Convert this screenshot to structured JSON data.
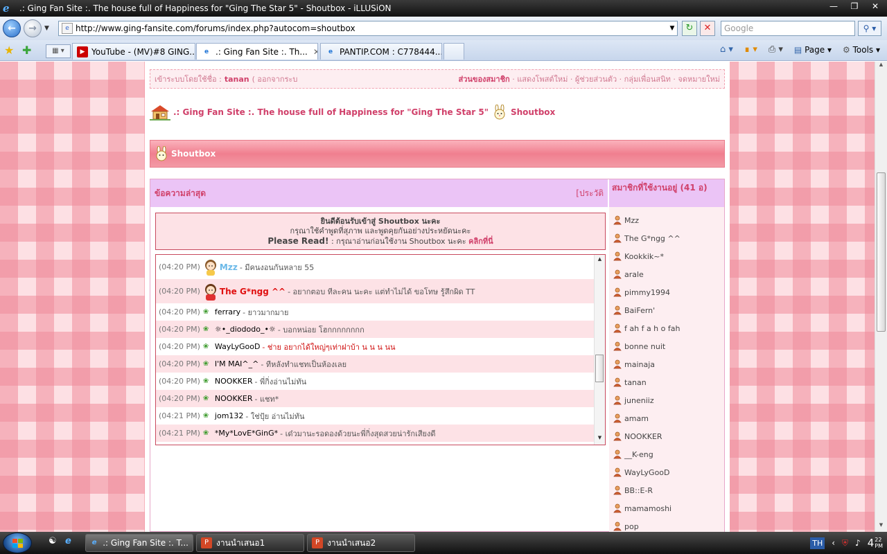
{
  "window": {
    "title": ".: Ging Fan Site :. The house full of Happiness for \"Ging The Star 5\" - Shoutbox - iLLUSiON"
  },
  "address": {
    "url": "http://www.ging-fansite.com/forums/index.php?autocom=shoutbox",
    "search_placeholder": "Google"
  },
  "tabs": [
    {
      "label": "YouTube - (MV)#8 GING...",
      "icon": "youtube-icon"
    },
    {
      "label": ".: Ging Fan Site :. Th...",
      "icon": "ie-page-icon"
    },
    {
      "label": "PANTIP.COM : C778444...",
      "icon": "ie-page-icon"
    }
  ],
  "command_bar": {
    "page": "Page",
    "tools": "Tools"
  },
  "userbar": {
    "logged_in_label": "เข้าระบบโดยใช้ชื่อ :",
    "username": "tanan",
    "logout": "( ออกจากระบ",
    "member_area": "ส่วนของสมาชิก",
    "links": "· แสดงโพสต์ใหม่ · ผู้ช่วยส่วนตัว · กลุ่มเพื่อนสนิท · จดหมายใหม่"
  },
  "breadcrumb": {
    "site": ".: Ging Fan Site :. The house full of Happiness for \"Ging The Star 5\"",
    "current": "Shoutbox"
  },
  "shoutbox": {
    "header": "Shoutbox",
    "latest_title": "ข้อความล่าสุด",
    "history": "[ประวัติ",
    "online_title": "สมาชิกที่ใช้งานอยู่ (41 อ)",
    "welcome_line1": "ยินดีต้อนรับเข้าสู่ Shoutbox นะคะ",
    "welcome_line2": "กรุณาใช้คำพูดที่สุภาพ และพูดคุยกันอย่างประหยัดนะคะ",
    "please_read": "Please Read!",
    "welcome_line3": ": กรุณาอ่านก่อนใช้งาน Shoutbox นะคะ",
    "click_here": "คลิกที่นี่"
  },
  "messages": [
    {
      "time": "(04:20 PM)",
      "name": "Mzz",
      "text": "- มีคนงอนกันหลาย 55",
      "style": "blue",
      "avatar": "girl-avatar-icon"
    },
    {
      "time": "(04:20 PM)",
      "name": "The G*ngg ^^",
      "text": "- อยากตอบ ทีละคน นะคะ แต่ทำไม่ได้ ขอโทษ รู้สึกผิด TT",
      "style": "red",
      "avatar": "girl-red-avatar-icon"
    },
    {
      "time": "(04:20 PM)",
      "name": "ferrary",
      "text": "- ยาวมากมาย",
      "style": "normal"
    },
    {
      "time": "(04:20 PM)",
      "name": "☼•_diododo_•☼",
      "text": "- บอกหน่อย โฮกกกกกกกก",
      "style": "normal"
    },
    {
      "time": "(04:20 PM)",
      "name": "WayLyGooD",
      "text": "- ช่าย อยากได้ใหญ่ๆเท่าฝาบ้า น น น นน",
      "style": "normal-redtext"
    },
    {
      "time": "(04:20 PM)",
      "name": "I'M MAI^_^",
      "text": "- ทีหลังทำแชทเป็นห้องเลย",
      "style": "normal"
    },
    {
      "time": "(04:20 PM)",
      "name": "NOOKKER",
      "text": "- พี่กิ่งอ่านไม่ทัน",
      "style": "normal"
    },
    {
      "time": "(04:20 PM)",
      "name": "NOOKKER",
      "text": "- แชท*",
      "style": "normal"
    },
    {
      "time": "(04:21 PM)",
      "name": "jom132",
      "text": "- ใช่ปุ้ย อ่านไม่ทัน",
      "style": "normal"
    },
    {
      "time": "(04:21 PM)",
      "name": "*My*LovE*GinG*",
      "text": "- เด๋วมานะรอดองด้วยนะพี่กิ่งสุดสวยน่ารักเสียงดี",
      "style": "normal"
    }
  ],
  "members": [
    "Mzz",
    "The G*ngg ^^",
    "Kookkik~*",
    "arale",
    "pimmy1994",
    "BaiFern'",
    "f ah f a h o fah",
    "bonne nuit",
    "mainaja",
    "tanan",
    "juneniiz",
    "amam",
    "NOOKKER",
    "__K-eng",
    "WayLyGooD",
    "BB::E-R",
    "mamamoshi",
    "pop"
  ],
  "taskbar": {
    "tasks": [
      {
        "label": ".: Ging Fan Site :. T...",
        "icon": "ie-icon"
      },
      {
        "label": "งานนำเสนอ1",
        "icon": "powerpoint-icon"
      },
      {
        "label": "งานนำเสนอ2",
        "icon": "powerpoint-icon"
      }
    ],
    "lang": "TH",
    "time": "4",
    "time_min": "22",
    "time_ampm": "PM"
  },
  "colors": {
    "accent_pink": "#d0406a",
    "header_lilac": "#ebc4f6",
    "row_pink": "#fde2e6"
  }
}
